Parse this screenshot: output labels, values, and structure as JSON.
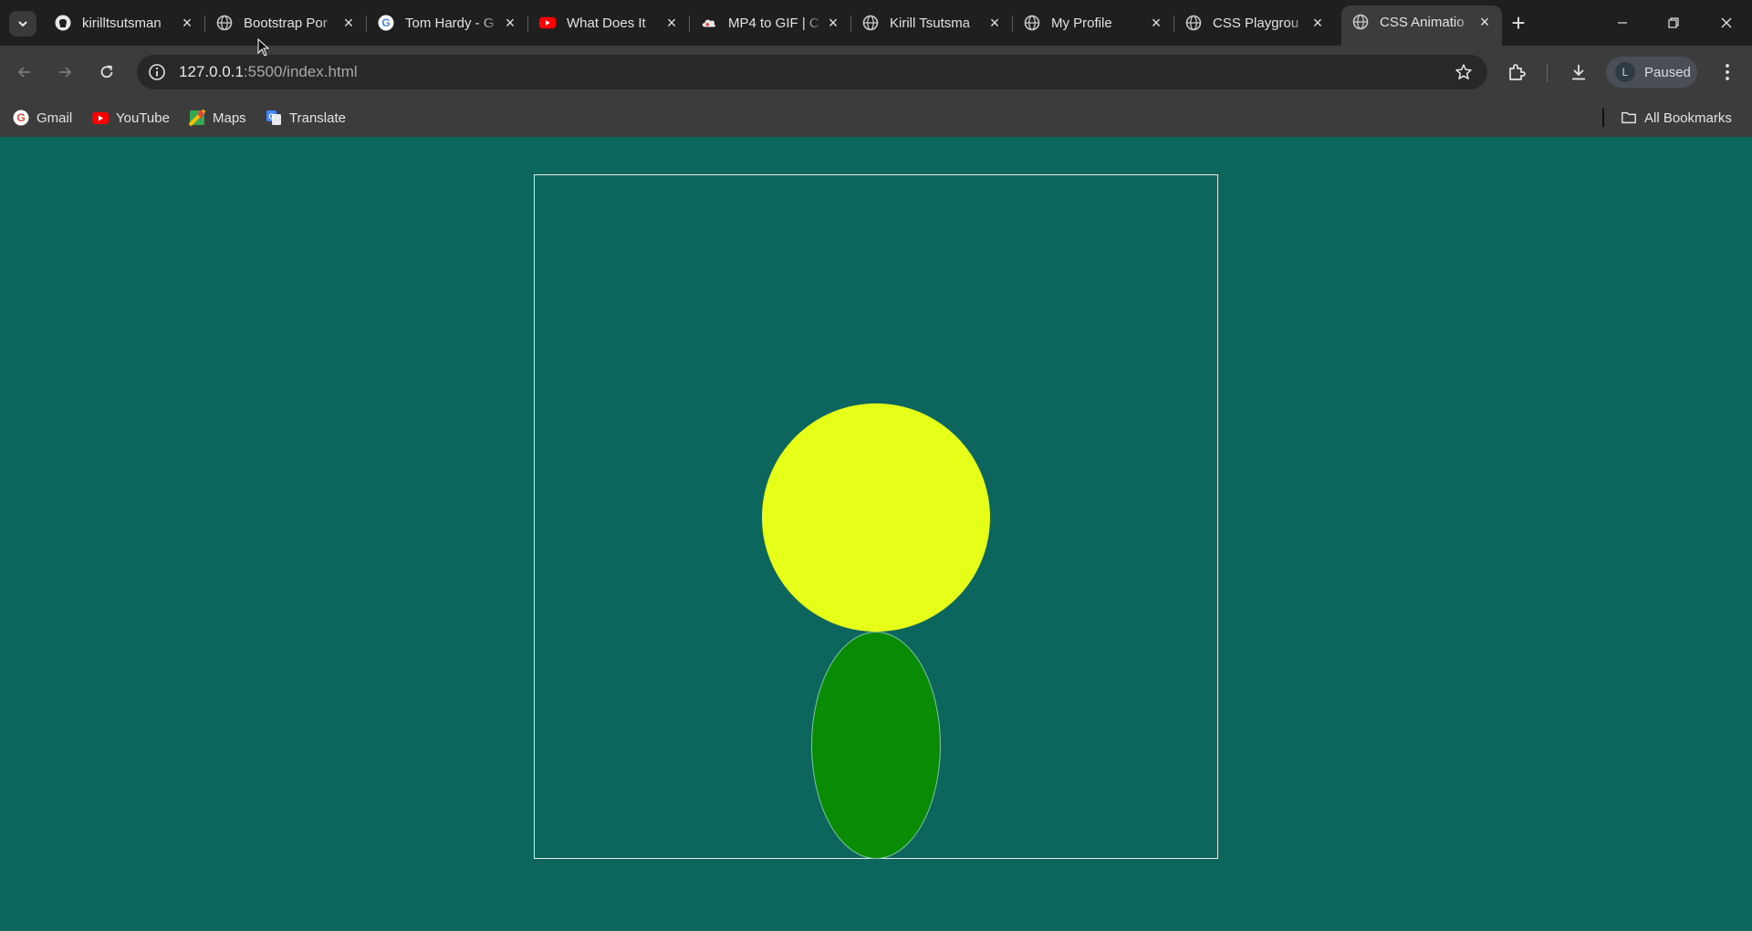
{
  "tabs": [
    {
      "title": "kirilltsutsman",
      "icon": "github-icon"
    },
    {
      "title": "Bootstrap Por",
      "icon": "globe-icon"
    },
    {
      "title": "Tom Hardy - G",
      "icon": "google-icon"
    },
    {
      "title": "What Does It",
      "icon": "youtube-icon"
    },
    {
      "title": "MP4 to GIF | C",
      "icon": "cloud-icon"
    },
    {
      "title": "Kirill Tsutsma",
      "icon": "globe-icon"
    },
    {
      "title": "My Profile",
      "icon": "globe-icon"
    },
    {
      "title": "CSS Playgrou",
      "icon": "globe-icon"
    },
    {
      "title": "CSS Animatio",
      "icon": "globe-icon",
      "active": true
    }
  ],
  "address_bar": {
    "host": "127.0.0.1",
    "path": ":5500/index.html"
  },
  "profile": {
    "initial": "L",
    "status": "Paused"
  },
  "bookmarks": [
    {
      "label": "Gmail",
      "icon": "google-icon"
    },
    {
      "label": "YouTube",
      "icon": "youtube-icon"
    },
    {
      "label": "Maps",
      "icon": "maps-icon"
    },
    {
      "label": "Translate",
      "icon": "translate-icon"
    }
  ],
  "all_bookmarks_label": "All Bookmarks",
  "colors": {
    "page_background": "#0c665e",
    "sun": "#e6ff18",
    "ellipse": "#0a8b06",
    "stage_border": "#e6efe9"
  }
}
